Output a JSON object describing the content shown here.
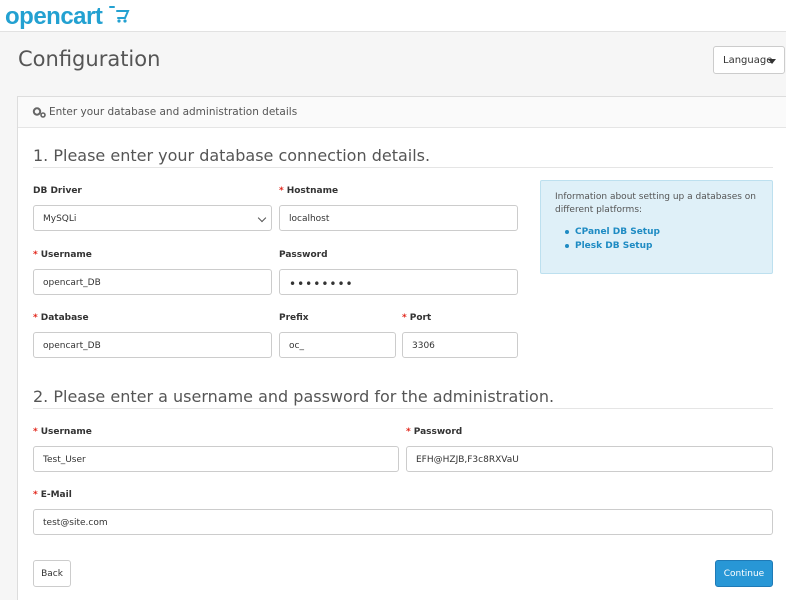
{
  "brand": {
    "logo_text": "opencart",
    "accent": "#23a1d1"
  },
  "header": {
    "title": "Configuration",
    "language_label": "Language"
  },
  "panel": {
    "heading": "Enter your database and administration details",
    "section1": {
      "title": "1. Please enter your database connection details.",
      "db_driver": {
        "label": "DB Driver",
        "value": "MySQLi",
        "required": false
      },
      "hostname": {
        "label": "Hostname",
        "value": "localhost",
        "required": true
      },
      "username": {
        "label": "Username",
        "value": "opencart_DB",
        "required": true
      },
      "password": {
        "label": "Password",
        "value": "••••••••",
        "required": false
      },
      "database": {
        "label": "Database",
        "value": "opencart_DB",
        "required": true
      },
      "prefix": {
        "label": "Prefix",
        "value": "oc_",
        "required": false
      },
      "port": {
        "label": "Port",
        "value": "3306",
        "required": true
      }
    },
    "info": {
      "text": "Information about setting up a databases on different platforms:",
      "links": [
        "CPanel DB Setup",
        "Plesk DB Setup"
      ]
    },
    "section2": {
      "title": "2. Please enter a username and password for the administration.",
      "username": {
        "label": "Username",
        "value": "Test_User",
        "required": true
      },
      "password": {
        "label": "Password",
        "value": "EFH@HZJB,F3c8RXVaU",
        "required": true
      },
      "email": {
        "label": "E-Mail",
        "value": "test@site.com",
        "required": true
      }
    },
    "buttons": {
      "back": "Back",
      "continue": "Continue"
    }
  },
  "colors": {
    "required": "#e2261b",
    "primary_button": "#2897d6",
    "info_bg": "#dff0f8",
    "link": "#1e8bc3"
  },
  "icons": {
    "logo_cart": "shopping-cart-icon",
    "panel_heading": "cogs-icon",
    "language_caret": "caret-down-icon",
    "select_chevron": "chevron-down-icon"
  }
}
